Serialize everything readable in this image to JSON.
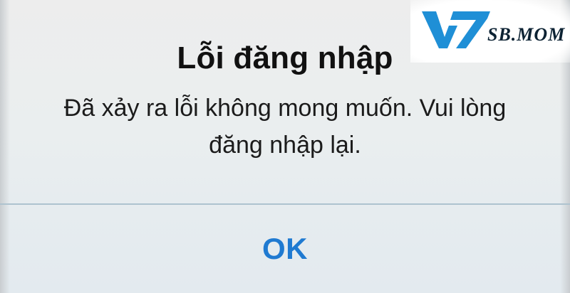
{
  "dialog": {
    "title": "Lỗi đăng nhập",
    "message": "Đã xảy ra lỗi không mong muốn. Vui lòng đăng nhập lại.",
    "ok_label": "OK"
  },
  "logo": {
    "mark": "V7",
    "suffix": "SB.MOM"
  },
  "colors": {
    "accent": "#1f7ad1",
    "logo_blue": "#1f8fd6",
    "divider": "#aec3cf"
  }
}
